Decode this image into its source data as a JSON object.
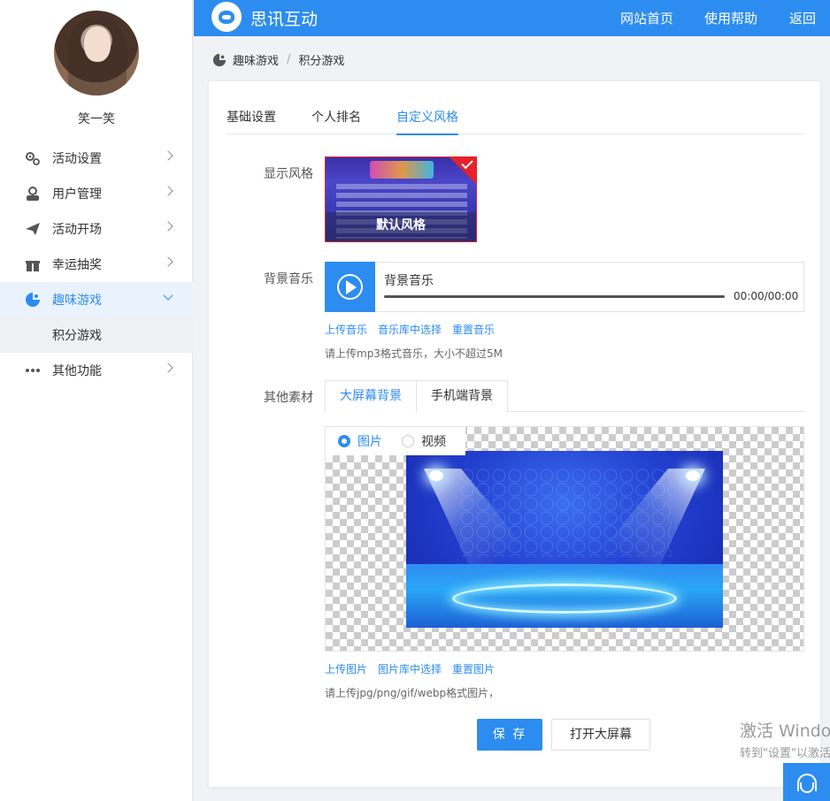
{
  "sidebar": {
    "username": "笑一笑",
    "menu": [
      {
        "label": "活动设置",
        "icon": "gears-icon"
      },
      {
        "label": "用户管理",
        "icon": "user-icon"
      },
      {
        "label": "活动开场",
        "icon": "paper-plane-icon"
      },
      {
        "label": "幸运抽奖",
        "icon": "gift-icon"
      },
      {
        "label": "趣味游戏",
        "icon": "game-icon",
        "active": true
      },
      {
        "label": "其他功能",
        "icon": "more-dots-icon"
      }
    ],
    "submenu": [
      "积分游戏"
    ]
  },
  "topbar": {
    "brand": "思讯互动",
    "links": [
      "网站首页",
      "使用帮助",
      "返回"
    ]
  },
  "breadcrumb": [
    "趣味游戏",
    "积分游戏"
  ],
  "tabs": [
    "基础设置",
    "个人排名",
    "自定义风格"
  ],
  "form": {
    "style_label": "显示风格",
    "style_name": "默认风格",
    "music_label": "背景音乐",
    "player_title": "背景音乐",
    "player_time": "00:00/00:00",
    "music_links": [
      "上传音乐",
      "音乐库中选择",
      "重置音乐"
    ],
    "music_hint": "请上传mp3格式音乐，大小不超过5M",
    "material_label": "其他素材",
    "material_tabs": [
      "大屏幕背景",
      "手机端背景"
    ],
    "media_types": [
      "图片",
      "视频"
    ],
    "image_links": [
      "上传图片",
      "图片库中选择",
      "重置图片"
    ],
    "image_hint": "请上传jpg/png/gif/webp格式图片，",
    "save": "保 存",
    "open_screen": "打开大屏幕"
  },
  "watermark": {
    "line1": "激活 Windows",
    "line2": "转到\"设置\"以激活"
  },
  "colors": {
    "primary": "#2d8cf0",
    "selected_border": "#e6212a"
  }
}
